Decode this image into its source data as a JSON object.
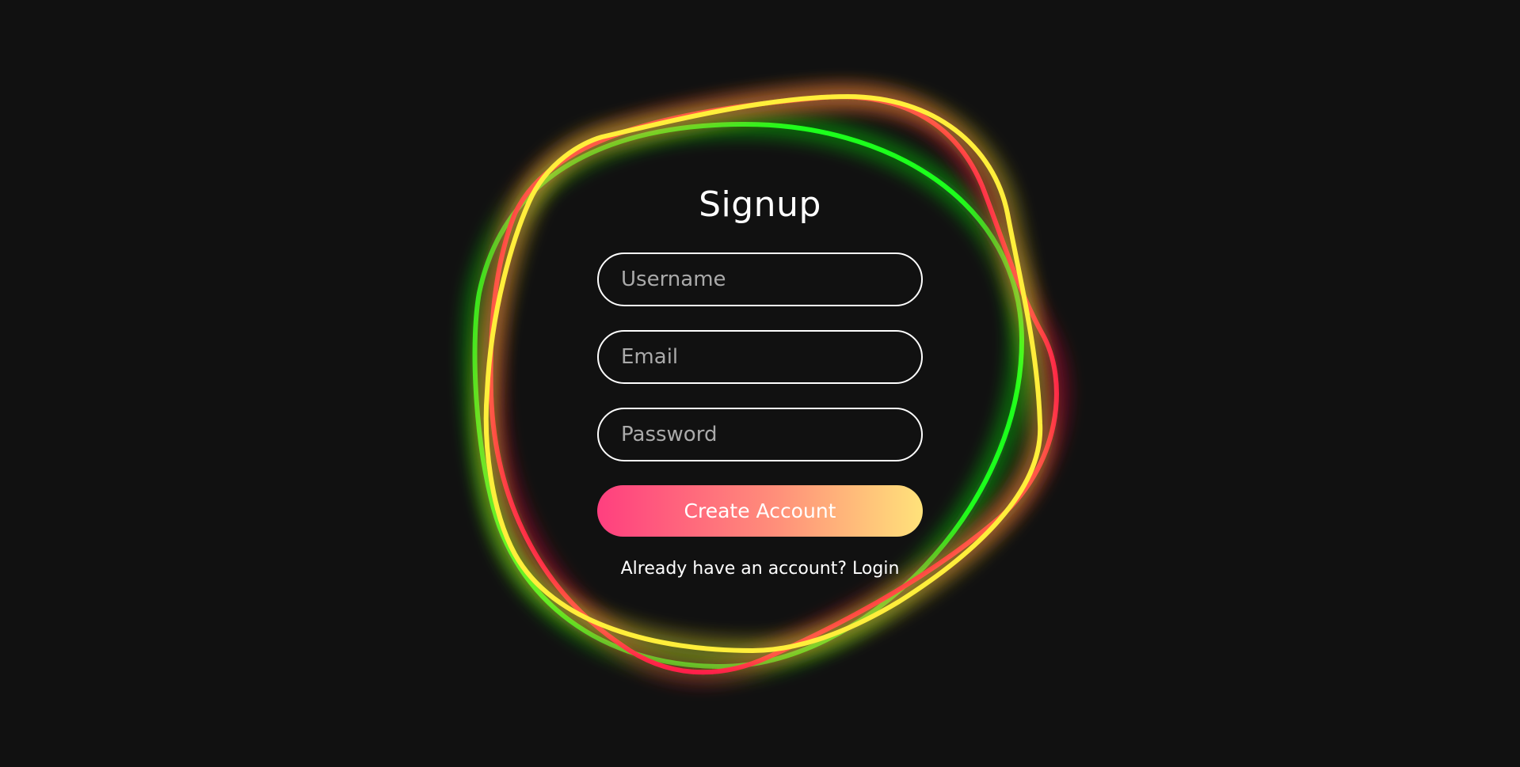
{
  "form": {
    "title": "Signup",
    "username_placeholder": "Username",
    "email_placeholder": "Email",
    "password_placeholder": "Password",
    "submit_label": "Create Account",
    "login_prompt": "Already have an account?",
    "login_link": "Login"
  },
  "colors": {
    "background": "#111111",
    "ring_green": "#1aff1a",
    "ring_red": "#ff1f4b",
    "ring_yellow": "#ffee3b",
    "button_gradient_start": "#ff3f7f",
    "button_gradient_end": "#ffe27a"
  }
}
